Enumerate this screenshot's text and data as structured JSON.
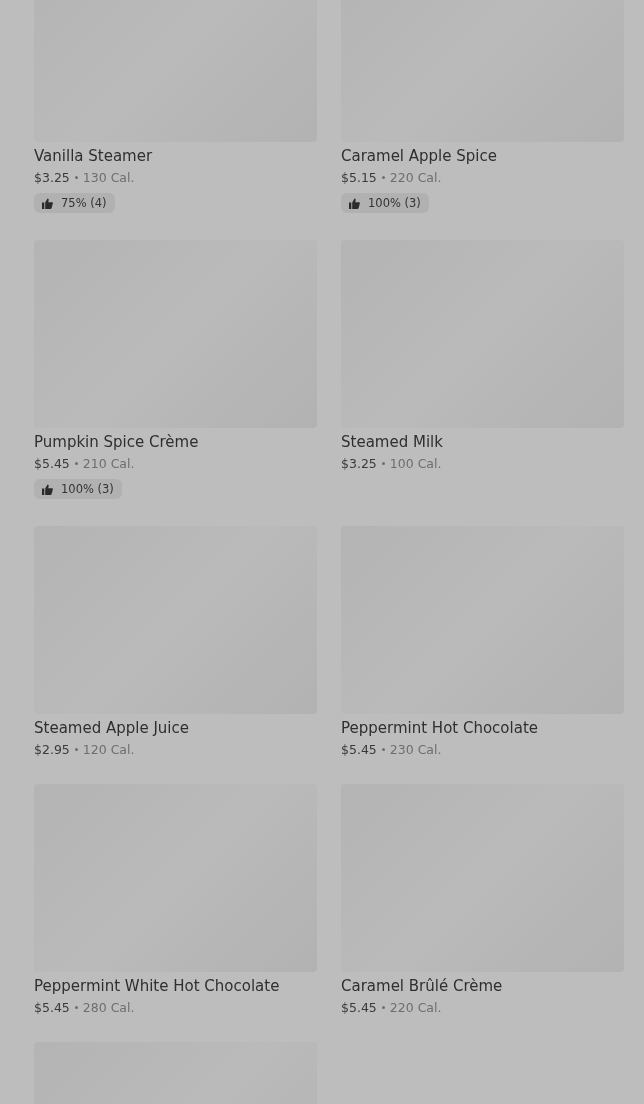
{
  "items": [
    {
      "kind": "item",
      "name": "Vanilla Steamer",
      "price": "$3.25",
      "calories": "130 Cal.",
      "rating": "75% (4)"
    },
    {
      "kind": "item",
      "name": "Caramel Apple Spice",
      "price": "$5.15",
      "calories": "220 Cal.",
      "rating": "100% (3)"
    },
    {
      "kind": "item",
      "name": "Pumpkin Spice Crème",
      "price": "$5.45",
      "calories": "210 Cal.",
      "rating": "100% (3)"
    },
    {
      "kind": "item",
      "name": "Steamed Milk",
      "price": "$3.25",
      "calories": "100 Cal."
    },
    {
      "kind": "item",
      "name": "Steamed Apple Juice",
      "price": "$2.95",
      "calories": "120 Cal."
    },
    {
      "kind": "item",
      "name": "Peppermint Hot Chocolate",
      "price": "$5.45",
      "calories": "230 Cal."
    },
    {
      "kind": "item",
      "name": "Peppermint White Hot Chocolate",
      "price": "$5.45",
      "calories": "280 Cal."
    },
    {
      "kind": "item",
      "name": "Caramel Brûlé Crème",
      "price": "$5.45",
      "calories": "220 Cal."
    },
    {
      "kind": "picture"
    }
  ]
}
